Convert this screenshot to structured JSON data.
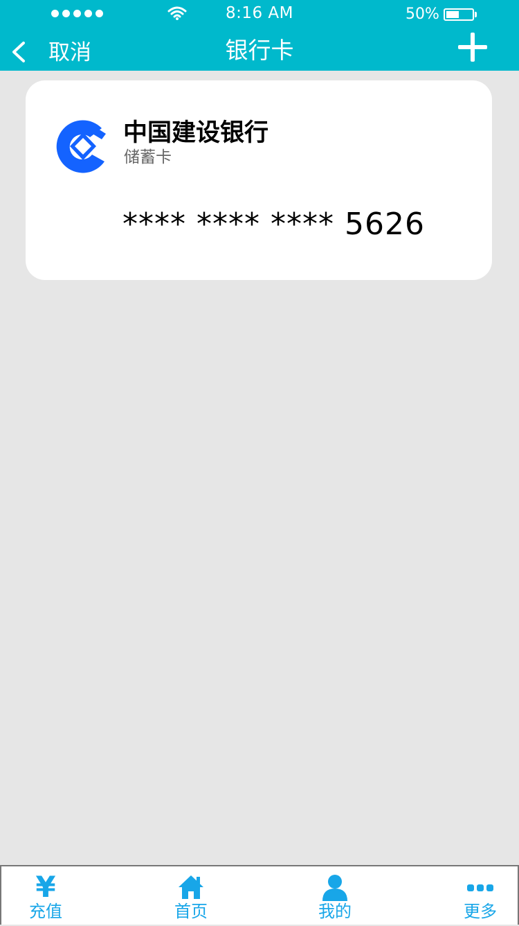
{
  "status_bar": {
    "time": "8:16 AM",
    "battery": "50%",
    "battery_level": 0.5
  },
  "nav": {
    "cancel_label": "取消",
    "title": "银行卡"
  },
  "card": {
    "bank_name": "中国建设银行",
    "card_type": "储蓄卡",
    "card_number": "**** **** **** 5626"
  },
  "tabbar": {
    "items": [
      {
        "label": "充值",
        "icon": "yen-icon"
      },
      {
        "label": "首页",
        "icon": "home-icon"
      },
      {
        "label": "我的",
        "icon": "user-icon"
      },
      {
        "label": "更多",
        "icon": "more-icon"
      }
    ]
  },
  "colors": {
    "header": "#00b9cc",
    "tab_accent": "#18a6e8",
    "logo": "#1463ff",
    "background": "#e6e6e6"
  }
}
